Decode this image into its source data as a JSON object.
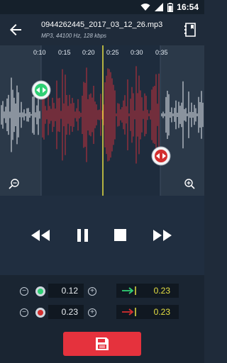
{
  "status": {
    "time": "16:54"
  },
  "file": {
    "name": "0944262445_2017_03_12_26.mp3",
    "info": "MP3, 44100 Hz, 128 kbps"
  },
  "timeline": {
    "ticks": [
      "0:10",
      "0:15",
      "0:20",
      "0:25",
      "0:30",
      "0:35"
    ]
  },
  "start": {
    "value": "0.12",
    "marker_color": "#2fcf74",
    "fine_value": "0.23"
  },
  "end": {
    "value": "0.23",
    "marker_color": "#d32f2f",
    "fine_value": "0.23"
  },
  "colors": {
    "selection_wave": "#c7303a",
    "outside_wave": "#e8edf2",
    "playhead": "#e6e043",
    "save_button": "#e5323d"
  }
}
